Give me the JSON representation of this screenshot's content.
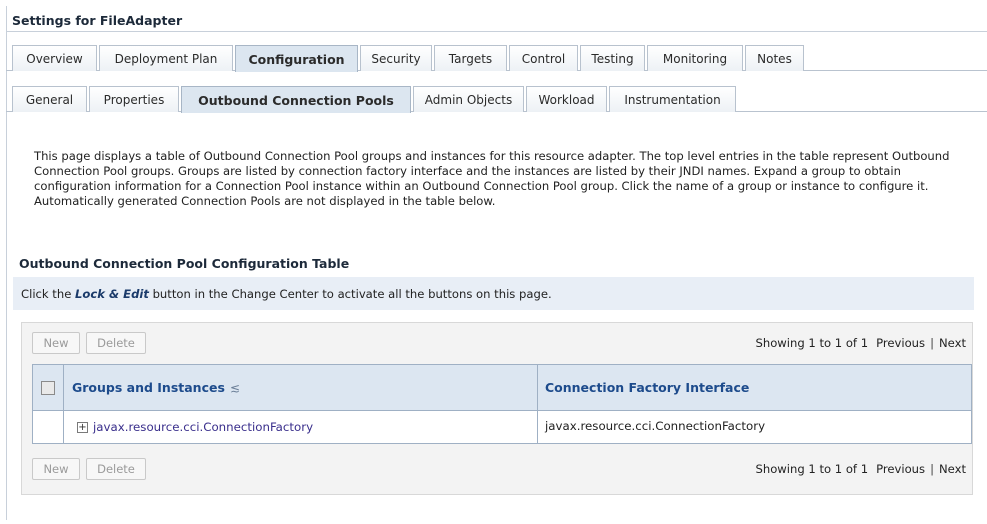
{
  "page": {
    "title": "Settings for FileAdapter"
  },
  "main_tabs": [
    {
      "label": "Overview"
    },
    {
      "label": "Deployment Plan"
    },
    {
      "label": "Configuration",
      "active": true
    },
    {
      "label": "Security"
    },
    {
      "label": "Targets"
    },
    {
      "label": "Control"
    },
    {
      "label": "Testing"
    },
    {
      "label": "Monitoring"
    },
    {
      "label": "Notes"
    }
  ],
  "sub_tabs": [
    {
      "label": "General"
    },
    {
      "label": "Properties"
    },
    {
      "label": "Outbound Connection Pools",
      "active": true
    },
    {
      "label": "Admin Objects"
    },
    {
      "label": "Workload"
    },
    {
      "label": "Instrumentation"
    }
  ],
  "description": "This page displays a table of Outbound Connection Pool groups and instances for this resource adapter. The top level entries in the table represent Outbound Connection Pool groups. Groups are listed by connection factory interface and the instances are listed by their JNDI names. Expand a group to obtain configuration information for a Connection Pool instance within an Outbound Connection Pool group. Click the name of a group or instance to configure it. Automatically generated Connection Pools are not displayed in the table below.",
  "table_section": {
    "title": "Outbound Connection Pool Configuration Table",
    "info": {
      "prefix": "Click the ",
      "lock_label": "Lock & Edit",
      "suffix": " button in the Change Center to activate all the buttons on this page."
    },
    "buttons": {
      "new_label": "New",
      "delete_label": "Delete"
    },
    "pager": {
      "showing": "Showing 1 to 1 of 1",
      "previous": "Previous",
      "separator": "|",
      "next": "Next"
    },
    "columns": {
      "groups": "Groups and Instances",
      "sort_glyph": "≲",
      "factory": "Connection Factory Interface"
    },
    "rows": [
      {
        "expand_glyph": "+",
        "group": "javax.resource.cci.ConnectionFactory",
        "factory_interface": "javax.resource.cci.ConnectionFactory"
      }
    ]
  },
  "colors": {
    "header_bg": "#dce6f1",
    "link": "#3a2f8c",
    "heading_link": "#1d4b8c",
    "info_bg": "#e8eef6"
  }
}
